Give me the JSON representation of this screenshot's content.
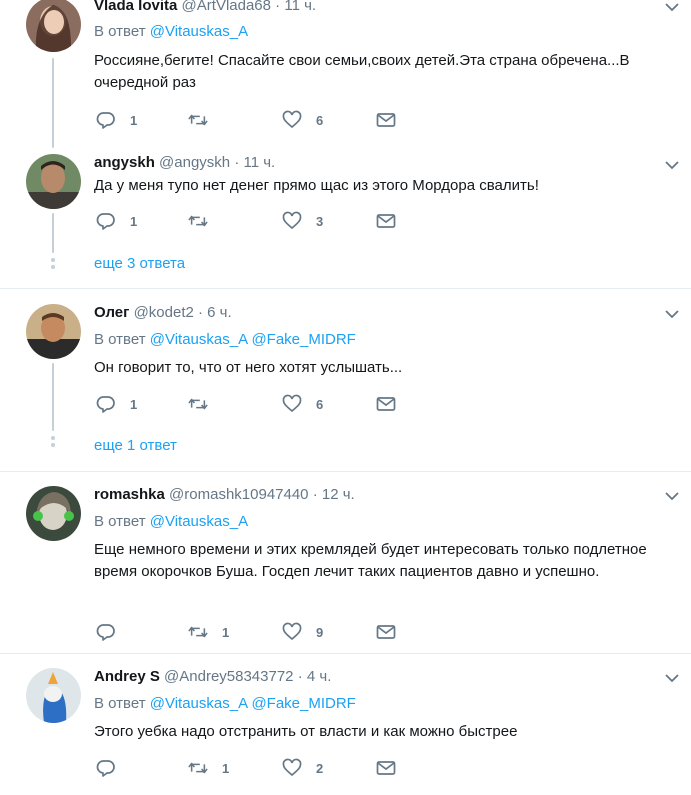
{
  "tweets": [
    {
      "name": "Vlada Iovita",
      "handle": "@ArtVlada68",
      "time": "11 ч.",
      "reply_prefix": "В ответ",
      "mentions": [
        "@Vitauskas_A"
      ],
      "text": "Россияне,бегите! Спасайте свои семьи,своих детей.Эта страна обречена...В очередной раз",
      "replies": "1",
      "retweets": "",
      "likes": "6"
    },
    {
      "name": "angyskh",
      "handle": "@angyskh",
      "time": "11 ч.",
      "text": "Да у меня тупо нет денег прямо щас из этого Мордора свалить!",
      "replies": "1",
      "retweets": "",
      "likes": "3",
      "more_replies": "еще 3 ответа"
    },
    {
      "name": "Олег",
      "handle": "@kodet2",
      "time": "6 ч.",
      "reply_prefix": "В ответ",
      "mentions": [
        "@Vitauskas_A",
        "@Fake_MIDRF"
      ],
      "text": "Он говорит то, что от него хотят услышать...",
      "replies": "1",
      "retweets": "",
      "likes": "6",
      "more_replies": "еще 1 ответ"
    },
    {
      "name": "romashka",
      "handle": "@romashk10947440",
      "time": "12 ч.",
      "reply_prefix": "В ответ",
      "mentions": [
        "@Vitauskas_A"
      ],
      "text": "Еще немного времени и этих кремлядей будет интересовать только подлетное время окорочков Буша. Госдеп лечит таких пациентов давно и успешно.",
      "replies": "",
      "retweets": "1",
      "likes": "9"
    },
    {
      "name": "Andrey S",
      "handle": "@Andrey58343772",
      "time": "4 ч.",
      "reply_prefix": "В ответ",
      "mentions": [
        "@Vitauskas_A",
        "@Fake_MIDRF"
      ],
      "text": "Этого уебка надо отстранить от власти и как можно быстрее",
      "replies": "",
      "retweets": "1",
      "likes": "2"
    }
  ],
  "colors": {
    "accent": "#1da1f2",
    "muted": "#657786",
    "thread": "#c4cfd6",
    "divider": "#e6ecf0"
  },
  "icons": [
    "reply-icon",
    "retweet-icon",
    "like-icon",
    "direct-message-icon",
    "chevron-down-icon"
  ]
}
